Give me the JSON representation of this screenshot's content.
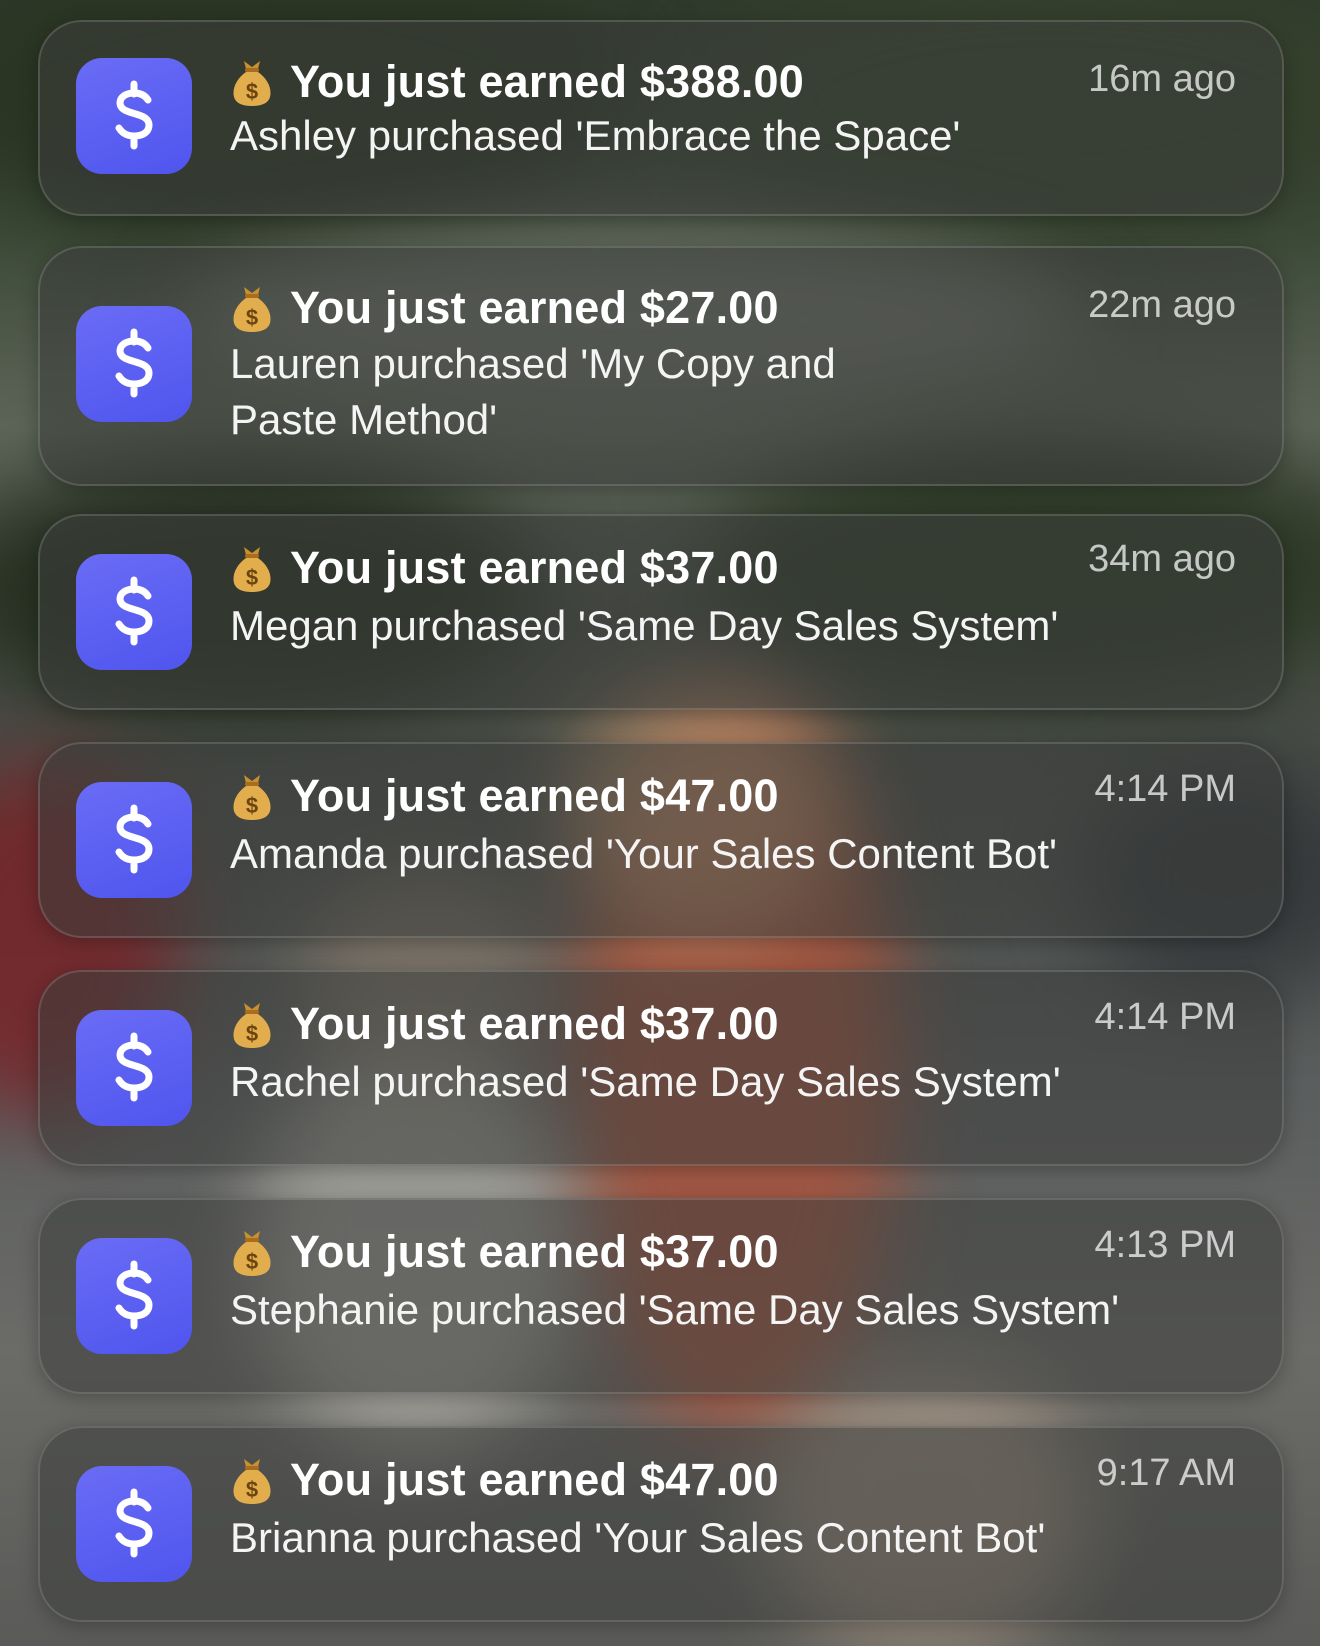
{
  "notifications": [
    {
      "title": "You just earned $388.00",
      "time": "16m ago",
      "body": "Ashley purchased 'Embrace the Space'"
    },
    {
      "title": "You just earned $27.00",
      "time": "22m ago",
      "body": "Lauren purchased 'My Copy and Paste Method'"
    },
    {
      "title": "You just earned $37.00",
      "time": "34m ago",
      "body": "Megan purchased 'Same Day Sales System'"
    },
    {
      "title": "You just earned $47.00",
      "time": "4:14 PM",
      "body": "Amanda purchased 'Your Sales Content Bot'"
    },
    {
      "title": "You just earned $37.00",
      "time": "4:14 PM",
      "body": "Rachel purchased 'Same Day Sales System'"
    },
    {
      "title": "You just earned $37.00",
      "time": "4:13 PM",
      "body": "Stephanie purchased 'Same Day Sales System'"
    },
    {
      "title": "You just earned $47.00",
      "time": "9:17 AM",
      "body": "Brianna purchased 'Your Sales Content Bot'"
    }
  ],
  "icons": {
    "app_icon": "dollar-sign-app-icon",
    "title_emoji": "money-bag-icon"
  },
  "colors": {
    "app_icon_accent": "#5b5ff0",
    "card_background": "#3c3e3c"
  }
}
